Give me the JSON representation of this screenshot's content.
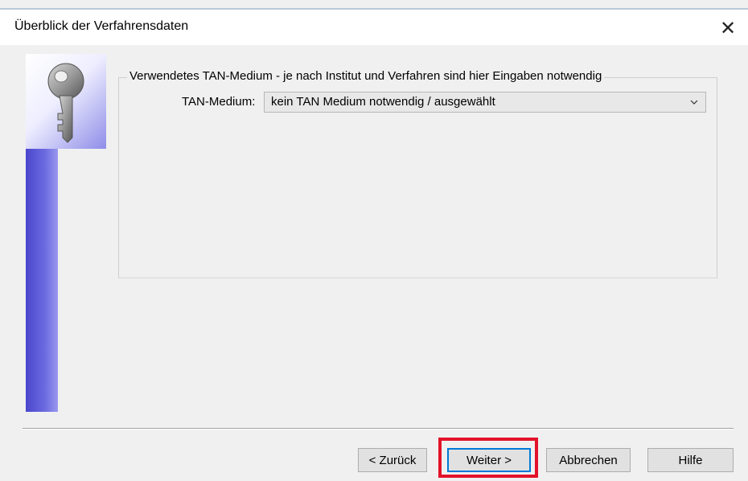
{
  "window": {
    "title": "Überblick der Verfahrensdaten",
    "close_symbol": "✕"
  },
  "group": {
    "legend": "Verwendetes TAN-Medium - je nach Institut und Verfahren sind hier Eingaben notwendig",
    "tan_label": "TAN-Medium:",
    "tan_value": "kein TAN Medium notwendig / ausgewählt"
  },
  "buttons": {
    "back": "< Zurück",
    "next": "Weiter >",
    "cancel": "Abbrechen",
    "help": "Hilfe"
  },
  "icons": {
    "key": "key-icon",
    "close": "close-icon",
    "dropdown": "chevron-down-icon"
  },
  "colors": {
    "accent_blue": "#0078d7",
    "highlight_red": "#e3122a",
    "sidebar_blue": "#4a46cc"
  }
}
